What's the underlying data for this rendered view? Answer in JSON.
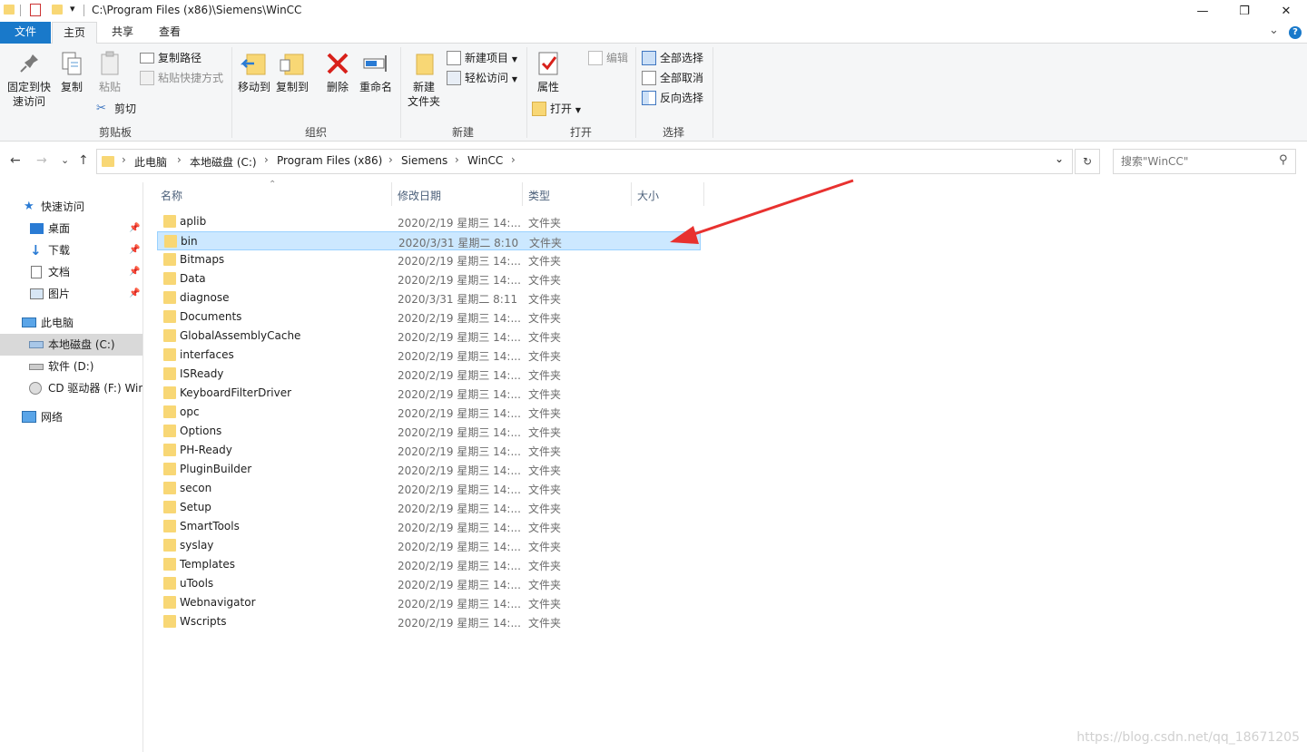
{
  "window": {
    "title": "C:\\Program Files (x86)\\Siemens\\WinCC",
    "minimize": "—",
    "restore": "❐",
    "close": "✕",
    "qat_dropdown": "▾"
  },
  "ribbon_tabs": [
    {
      "label": "文件"
    },
    {
      "label": "主页"
    },
    {
      "label": "共享"
    },
    {
      "label": "查看"
    }
  ],
  "ribbon": {
    "expand": "⌄",
    "help": "?",
    "clipboard": {
      "group_label": "剪贴板",
      "pin_line1": "固定到快",
      "pin_line2": "速访问",
      "copy": "复制",
      "paste": "粘贴",
      "copy_path": "复制路径",
      "paste_shortcut": "粘贴快捷方式",
      "cut": "剪切"
    },
    "organize": {
      "group_label": "组织",
      "move_to": "移动到",
      "copy_to": "复制到",
      "delete": "删除",
      "rename": "重命名"
    },
    "new": {
      "group_label": "新建",
      "new_folder_line1": "新建",
      "new_folder_line2": "文件夹",
      "new_item": "新建项目",
      "easy_access": "轻松访问"
    },
    "open": {
      "group_label": "打开",
      "properties": "属性",
      "open": "打开",
      "edit": "编辑"
    },
    "select": {
      "group_label": "选择",
      "select_all": "全部选择",
      "select_none": "全部取消",
      "invert": "反向选择"
    }
  },
  "nav": {
    "back": "←",
    "forward": "→",
    "recent": "⌄",
    "up": "↑",
    "breadcrumb": [
      "此电脑",
      "本地磁盘 (C:)",
      "Program Files (x86)",
      "Siemens",
      "WinCC"
    ],
    "separator": "›",
    "dropdown": "⌄",
    "refresh": "↻",
    "search_placeholder": "搜索\"WinCC\"",
    "search_icon": "⚲"
  },
  "sidebar": {
    "quick_access": "快速访问",
    "items": [
      {
        "label": "桌面",
        "pinned": true,
        "icon": "desktop-icon"
      },
      {
        "label": "下载",
        "pinned": true,
        "icon": "download-icon"
      },
      {
        "label": "文档",
        "pinned": true,
        "icon": "document-icon"
      },
      {
        "label": "图片",
        "pinned": true,
        "icon": "picture-icon"
      }
    ],
    "this_pc": "此电脑",
    "drives": [
      {
        "label": "本地磁盘 (C:)",
        "selected": true
      },
      {
        "label": "软件 (D:)",
        "selected": false
      },
      {
        "label": "CD 驱动器 (F:) Win",
        "selected": false
      }
    ],
    "network": "网络"
  },
  "file_list": {
    "columns": [
      "名称",
      "修改日期",
      "类型",
      "大小"
    ],
    "sort_indicator": "⌃",
    "rows": [
      {
        "name": "aplib",
        "date": "2020/2/19 星期三 14:...",
        "type": "文件夹",
        "selected": false
      },
      {
        "name": "bin",
        "date": "2020/3/31 星期二 8:10",
        "type": "文件夹",
        "selected": true
      },
      {
        "name": "Bitmaps",
        "date": "2020/2/19 星期三 14:...",
        "type": "文件夹",
        "selected": false
      },
      {
        "name": "Data",
        "date": "2020/2/19 星期三 14:...",
        "type": "文件夹",
        "selected": false
      },
      {
        "name": "diagnose",
        "date": "2020/3/31 星期二 8:11",
        "type": "文件夹",
        "selected": false
      },
      {
        "name": "Documents",
        "date": "2020/2/19 星期三 14:...",
        "type": "文件夹",
        "selected": false
      },
      {
        "name": "GlobalAssemblyCache",
        "date": "2020/2/19 星期三 14:...",
        "type": "文件夹",
        "selected": false
      },
      {
        "name": "interfaces",
        "date": "2020/2/19 星期三 14:...",
        "type": "文件夹",
        "selected": false
      },
      {
        "name": "ISReady",
        "date": "2020/2/19 星期三 14:...",
        "type": "文件夹",
        "selected": false
      },
      {
        "name": "KeyboardFilterDriver",
        "date": "2020/2/19 星期三 14:...",
        "type": "文件夹",
        "selected": false
      },
      {
        "name": "opc",
        "date": "2020/2/19 星期三 14:...",
        "type": "文件夹",
        "selected": false
      },
      {
        "name": "Options",
        "date": "2020/2/19 星期三 14:...",
        "type": "文件夹",
        "selected": false
      },
      {
        "name": "PH-Ready",
        "date": "2020/2/19 星期三 14:...",
        "type": "文件夹",
        "selected": false
      },
      {
        "name": "PluginBuilder",
        "date": "2020/2/19 星期三 14:...",
        "type": "文件夹",
        "selected": false
      },
      {
        "name": "secon",
        "date": "2020/2/19 星期三 14:...",
        "type": "文件夹",
        "selected": false
      },
      {
        "name": "Setup",
        "date": "2020/2/19 星期三 14:...",
        "type": "文件夹",
        "selected": false
      },
      {
        "name": "SmartTools",
        "date": "2020/2/19 星期三 14:...",
        "type": "文件夹",
        "selected": false
      },
      {
        "name": "syslay",
        "date": "2020/2/19 星期三 14:...",
        "type": "文件夹",
        "selected": false
      },
      {
        "name": "Templates",
        "date": "2020/2/19 星期三 14:...",
        "type": "文件夹",
        "selected": false
      },
      {
        "name": "uTools",
        "date": "2020/2/19 星期三 14:...",
        "type": "文件夹",
        "selected": false
      },
      {
        "name": "Webnavigator",
        "date": "2020/2/19 星期三 14:...",
        "type": "文件夹",
        "selected": false
      },
      {
        "name": "Wscripts",
        "date": "2020/2/19 星期三 14:...",
        "type": "文件夹",
        "selected": false
      }
    ]
  },
  "annotation": {
    "type": "arrow",
    "color": "#e8312f"
  },
  "watermark": "https://blog.csdn.net/qq_18671205",
  "colors": {
    "accent": "#1979ca",
    "selection": "#cce8ff",
    "folder": "#f8d775"
  }
}
